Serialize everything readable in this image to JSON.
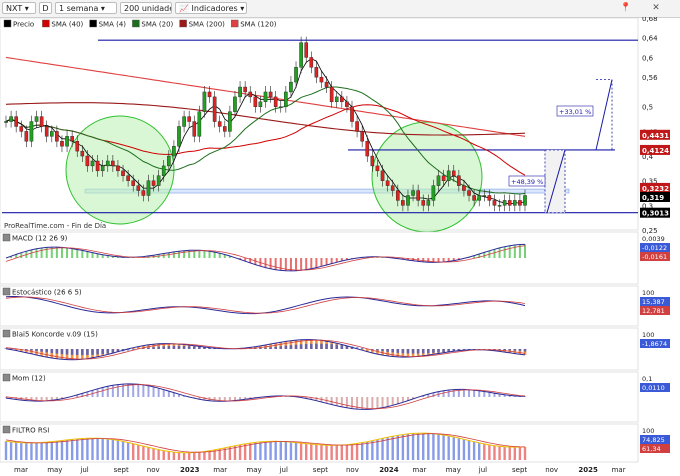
{
  "toolbar": {
    "ticker": "NXT",
    "period": "1 semana",
    "units": "200 unidades",
    "indicators": "Indicadores",
    "icons": {
      "D": "D",
      "close": "✕",
      "pin": "📍"
    }
  },
  "legend_main": [
    {
      "label": "Precio",
      "color": "#000000"
    },
    {
      "label": "SMA (40)",
      "color": "#d00000"
    },
    {
      "label": "SMA (4)",
      "color": "#000000"
    },
    {
      "label": "SMA (20)",
      "color": "#1e6e1e"
    },
    {
      "label": "SMA (200)",
      "color": "#9a1a1a"
    },
    {
      "label": "SMA (120)",
      "color": "#e04040"
    }
  ],
  "source_text": "ProRealTime.com - Fin de Día",
  "price_axis_labels": [
    "0,68",
    "0,64",
    "0,6",
    "0,56",
    "0,5",
    "0,45",
    "0,4",
    "0,35",
    "0,3",
    "0,25"
  ],
  "price_badges": [
    {
      "text": "0,4431",
      "color": "#c01818",
      "value": 0.4431
    },
    {
      "text": "0,4124",
      "color": "#c01818",
      "value": 0.4124
    },
    {
      "text": "0,3232",
      "color": "#c01818",
      "value": 0.3232
    },
    {
      "text": "0,319",
      "color": "#000000",
      "value": 0.319
    },
    {
      "text": "0,3013",
      "color": "#000000",
      "value": 0.3013
    }
  ],
  "annotations": {
    "upper": "+33,01 %",
    "lower": "+48,39 %"
  },
  "panels": [
    {
      "title": "MACD (12 26 9)",
      "labels": [
        "0,0039",
        "-0,0122",
        "-0,0161"
      ]
    },
    {
      "title": "Estocástico (26 6 5)",
      "labels": [
        "100",
        "15,387",
        "12,781"
      ]
    },
    {
      "title": "Blai5 Koncorde v.09 (15)",
      "labels": [
        "100",
        "-1,8674"
      ]
    },
    {
      "title": "Mom (12)",
      "labels": [
        "0,1",
        "0,0110"
      ]
    },
    {
      "title": "FILTRO RSI",
      "labels": [
        "100",
        "74,825",
        "61,34"
      ]
    }
  ],
  "time_axis": [
    "mar",
    "may",
    "jul",
    "sept",
    "nov",
    "2023",
    "mar",
    "may",
    "jul",
    "sept",
    "nov",
    "2024",
    "mar",
    "may",
    "jul",
    "sept",
    "nov",
    "2025",
    "mar"
  ],
  "chart_data": {
    "type": "candlestick",
    "ylim": [
      0.25,
      0.68
    ],
    "price_weekly": [
      0.47,
      0.48,
      0.46,
      0.45,
      0.43,
      0.47,
      0.48,
      0.46,
      0.44,
      0.45,
      0.43,
      0.42,
      0.44,
      0.43,
      0.41,
      0.4,
      0.38,
      0.39,
      0.37,
      0.38,
      0.39,
      0.38,
      0.37,
      0.36,
      0.35,
      0.34,
      0.33,
      0.32,
      0.35,
      0.34,
      0.36,
      0.38,
      0.4,
      0.42,
      0.46,
      0.48,
      0.47,
      0.44,
      0.49,
      0.53,
      0.52,
      0.47,
      0.46,
      0.45,
      0.49,
      0.52,
      0.54,
      0.53,
      0.52,
      0.5,
      0.51,
      0.53,
      0.52,
      0.5,
      0.5,
      0.53,
      0.55,
      0.58,
      0.63,
      0.6,
      0.58,
      0.56,
      0.55,
      0.54,
      0.51,
      0.52,
      0.51,
      0.5,
      0.47,
      0.45,
      0.43,
      0.4,
      0.38,
      0.37,
      0.35,
      0.34,
      0.33,
      0.31,
      0.3,
      0.32,
      0.33,
      0.31,
      0.3,
      0.31,
      0.34,
      0.36,
      0.35,
      0.37,
      0.36,
      0.34,
      0.33,
      0.32,
      0.31,
      0.32,
      0.32,
      0.31,
      0.3,
      0.3,
      0.31,
      0.3,
      0.31,
      0.3,
      0.32
    ],
    "levels": {
      "resistance_top": 0.635,
      "resistance_mid": 0.4124,
      "support_low": 0.3013,
      "channel_low": 0.325,
      "channel_high": 0.333
    }
  }
}
